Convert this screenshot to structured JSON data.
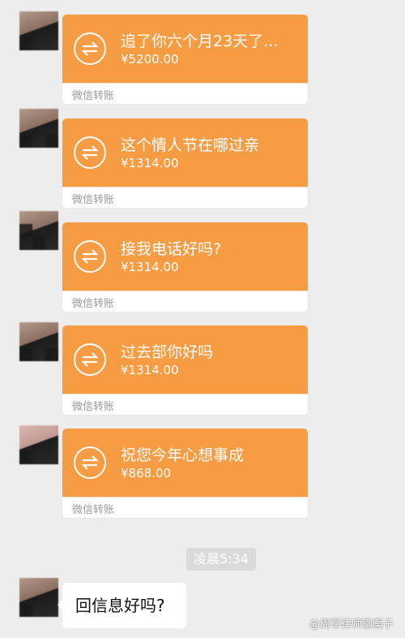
{
  "transfers": [
    {
      "title": "追了你六个月23天了...",
      "amount": "¥5200.00",
      "label": "微信转账"
    },
    {
      "title": "这个情人节在哪过亲",
      "amount": "¥1314.00",
      "label": "微信转账"
    },
    {
      "title": "接我电话好吗?",
      "amount": "¥1314.00",
      "label": "微信转账"
    },
    {
      "title": "过去部你好吗",
      "amount": "¥1314.00",
      "label": "微信转账"
    },
    {
      "title": "祝您今年心想事成",
      "amount": "¥868.00",
      "label": "微信转账"
    }
  ],
  "timestamp": "凌晨5:34",
  "text_message": "回信息好吗?",
  "watermark": "@周军律师聊案子",
  "colors": {
    "transfer_orange": "#f79c43",
    "chat_background": "#ededed"
  },
  "icons": {
    "transfer": "transfer-arrows-icon",
    "avatar": "blurred-avatar"
  }
}
